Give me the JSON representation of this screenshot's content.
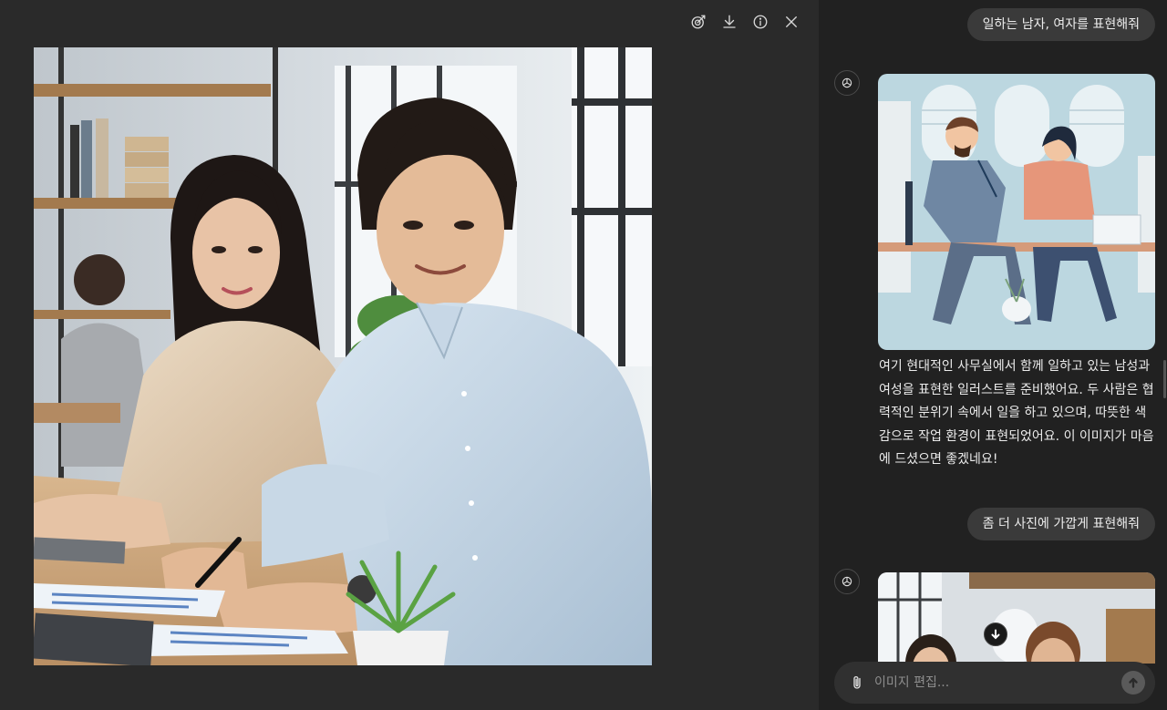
{
  "viewer": {
    "toolbar": [
      {
        "name": "edit-image-button",
        "icon": "brush-target-icon"
      },
      {
        "name": "download-button",
        "icon": "download-icon"
      },
      {
        "name": "info-button",
        "icon": "info-icon"
      },
      {
        "name": "close-button",
        "icon": "close-icon"
      }
    ],
    "image": {
      "subject": "office-man-woman-photoreal"
    }
  },
  "chat": {
    "messages": [
      {
        "role": "user",
        "text": "일하는 남자, 여자를 표현해줘"
      },
      {
        "role": "assistant",
        "image": "illustration",
        "text": "여기 현대적인 사무실에서 함께 일하고 있는 남성과 여성을 표현한 일러스트를 준비했어요. 두 사람은 협력적인 분위기 속에서 일을 하고 있으며, 따뜻한 색감으로 작업 환경이 표현되었어요. 이 이미지가 마음에 드셨으면 좋겠네요!"
      },
      {
        "role": "user",
        "text": "좀 더 사진에 가깝게 표현해줘"
      },
      {
        "role": "assistant",
        "image": "photo"
      }
    ],
    "composer": {
      "placeholder": "이미지 편집..."
    }
  },
  "colors": {
    "viewer_bg": "#2a2a2a",
    "chat_bg": "#212121",
    "bubble": "#3a3a3a"
  }
}
